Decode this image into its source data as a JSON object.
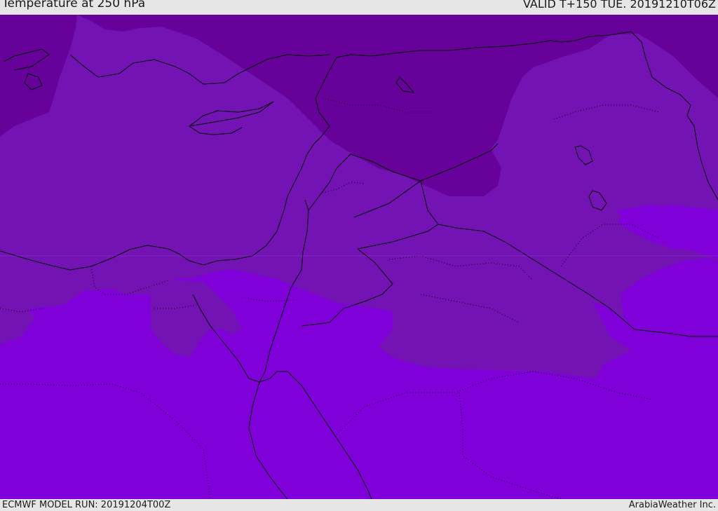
{
  "header": {
    "title": "Temperature at 250 hPa",
    "valid": "VALID T+150 TUE. 20191210T06Z"
  },
  "footer": {
    "model_run": "ECMWF MODEL RUN: 20191204T00Z",
    "credit": "ArabiaWeather Inc."
  },
  "map": {
    "colors": {
      "coldest": "#660299",
      "cold": "#7413b3",
      "mid": "#7a0ec8",
      "warm": "#8000da",
      "coast": "#000000"
    }
  }
}
